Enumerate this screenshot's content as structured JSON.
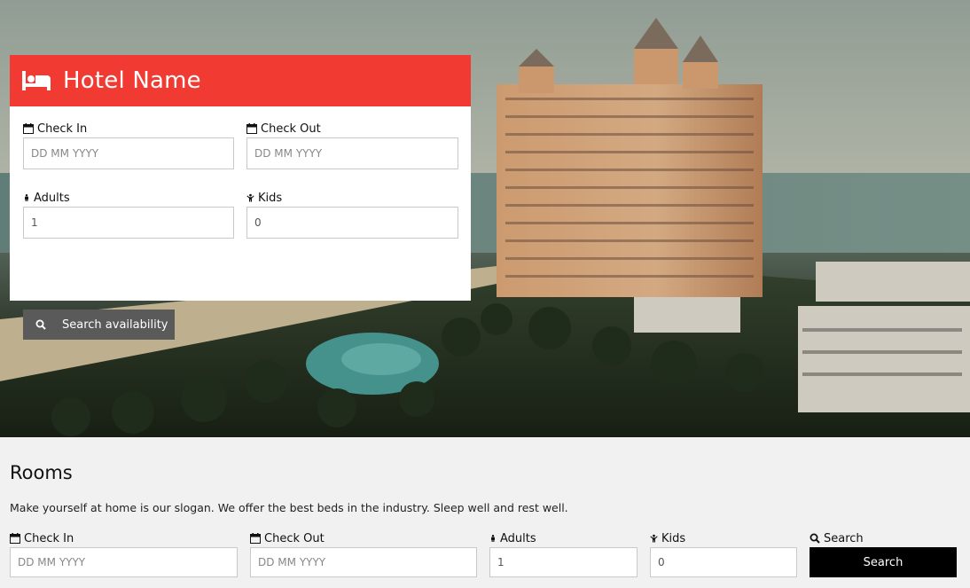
{
  "hero": {
    "panel": {
      "title": "Hotel Name",
      "icon": "bed-icon",
      "check_in": {
        "label": "Check In",
        "placeholder": "DD MM YYYY",
        "icon": "calendar-icon"
      },
      "check_out": {
        "label": "Check Out",
        "placeholder": "DD MM YYYY",
        "icon": "calendar-icon"
      },
      "adults": {
        "label": "Adults",
        "value": "1",
        "icon": "male-icon"
      },
      "kids": {
        "label": "Kids",
        "value": "0",
        "icon": "child-icon"
      },
      "search_button": {
        "label": "Search availability",
        "icon": "search-icon"
      }
    }
  },
  "rooms": {
    "title": "Rooms",
    "description": "Make yourself at home is our slogan. We offer the best beds in the industry. Sleep well and rest well.",
    "check_in": {
      "label": "Check In",
      "placeholder": "DD MM YYYY"
    },
    "check_out": {
      "label": "Check Out",
      "placeholder": "DD MM YYYY"
    },
    "adults": {
      "label": "Adults",
      "value": "1"
    },
    "kids": {
      "label": "Kids",
      "value": "0"
    },
    "search": {
      "label": "Search",
      "button_label": "Search"
    }
  },
  "colors": {
    "accent": "#f03a32",
    "button_dark": "#5a5a5a",
    "button_black": "#000000",
    "page_bg": "#f1f1f1"
  }
}
